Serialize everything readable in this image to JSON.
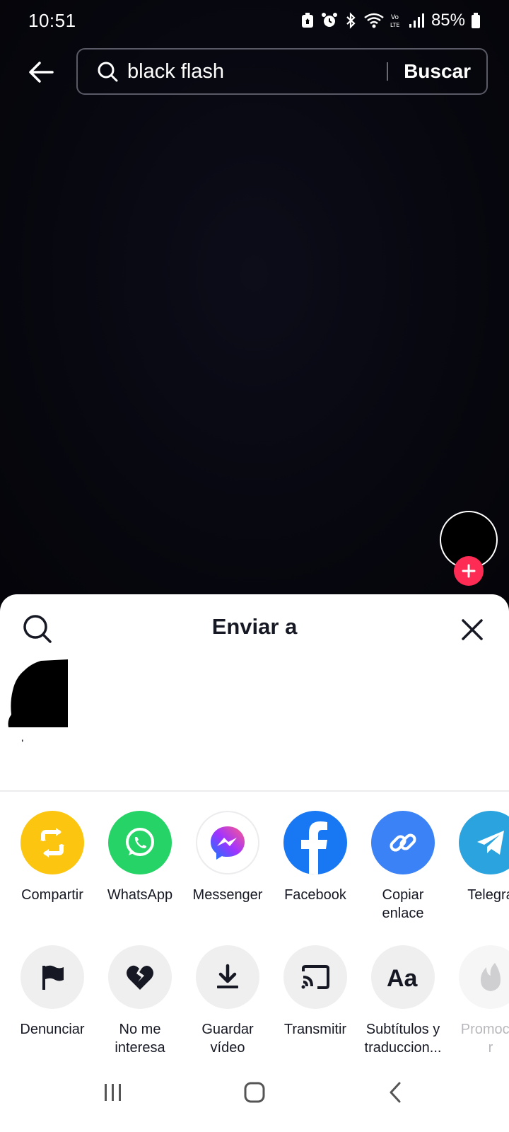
{
  "status": {
    "time": "10:51",
    "battery": "85%"
  },
  "search": {
    "query": "black flash",
    "submit_label": "Buscar"
  },
  "sheet": {
    "title": "Enviar a",
    "contacts": [
      {
        "name": "ʼ"
      }
    ],
    "share_options": [
      {
        "label": "Compartir",
        "icon": "repost-icon",
        "color": "#fcc50f"
      },
      {
        "label": "WhatsApp",
        "icon": "whatsapp-icon",
        "color": "#25d366"
      },
      {
        "label": "Messenger",
        "icon": "messenger-icon",
        "color": "#ffffff"
      },
      {
        "label": "Facebook",
        "icon": "facebook-icon",
        "color": "#1877f2"
      },
      {
        "label": "Copiar\nenlace",
        "icon": "link-icon",
        "color": "#3b82f6"
      },
      {
        "label": "Telegra",
        "icon": "telegram-icon",
        "color": "#2aa3de"
      }
    ],
    "actions": [
      {
        "label": "Denunciar",
        "icon": "flag-icon"
      },
      {
        "label": "No me\ninteresa",
        "icon": "broken-heart-icon"
      },
      {
        "label": "Guardar\nvídeo",
        "icon": "download-icon"
      },
      {
        "label": "Transmitir",
        "icon": "cast-icon"
      },
      {
        "label": "Subtítulos y\ntraduccion...",
        "icon": "subtitles-icon"
      },
      {
        "label": "Promocio\nr",
        "icon": "flame-icon"
      }
    ]
  },
  "colors": {
    "accent": "#fe2c55",
    "sheet_bg": "#ffffff",
    "video_bg": "#06060f"
  }
}
